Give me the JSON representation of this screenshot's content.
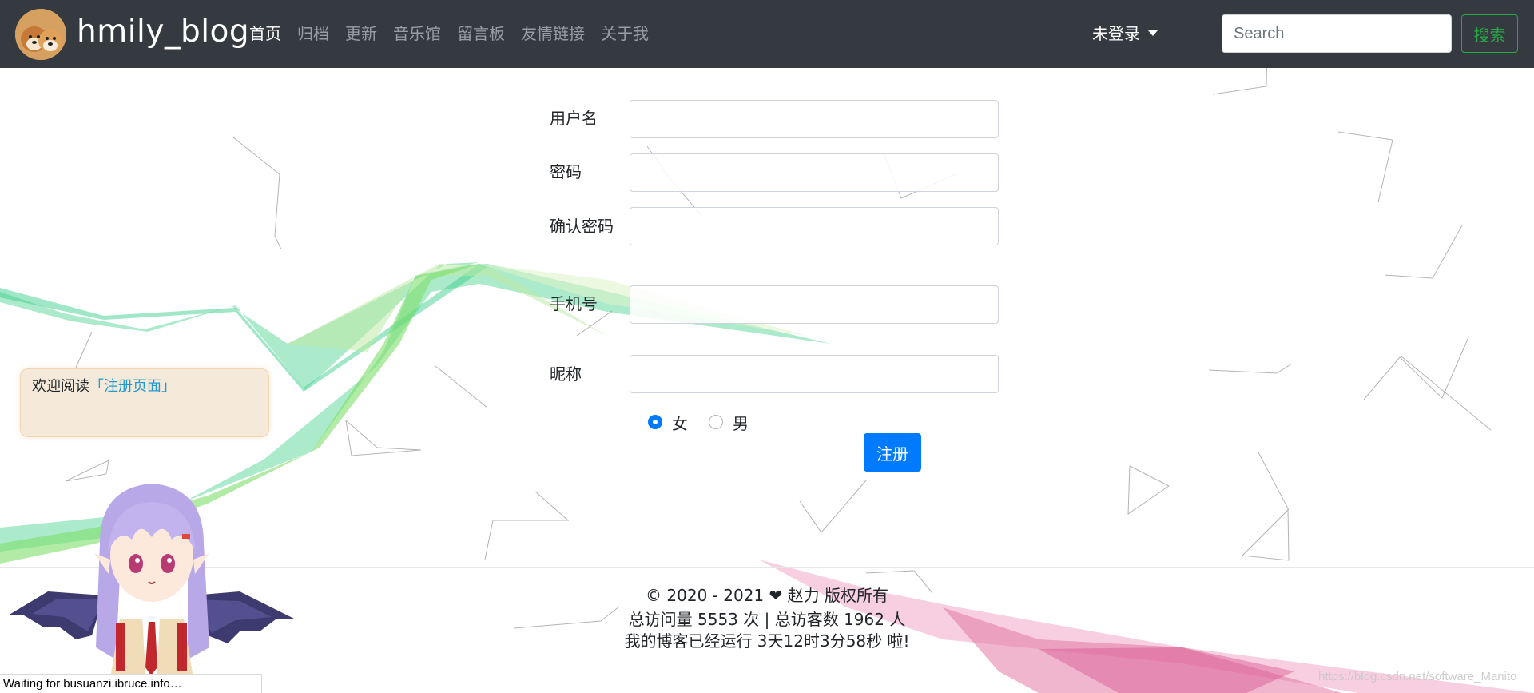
{
  "navbar": {
    "brand": "hmily_blog",
    "links": [
      {
        "label": "首页",
        "active": true
      },
      {
        "label": "归档",
        "active": false
      },
      {
        "label": "更新",
        "active": false
      },
      {
        "label": "音乐馆",
        "active": false
      },
      {
        "label": "留言板",
        "active": false
      },
      {
        "label": "友情链接",
        "active": false
      },
      {
        "label": "关于我",
        "active": false
      }
    ],
    "login_status": "未登录",
    "search_placeholder": "Search",
    "search_button": "搜索"
  },
  "form": {
    "username_label": "用户名",
    "password_label": "密码",
    "confirm_label": "确认密码",
    "phone_label": "手机号",
    "nickname_label": "昵称",
    "gender_options": [
      {
        "label": "女",
        "checked": true
      },
      {
        "label": "男",
        "checked": false
      }
    ],
    "submit_label": "注册"
  },
  "notice": {
    "prefix": "欢迎阅读",
    "link_text": "「注册页面」"
  },
  "footer": {
    "copyright": "© 2020 - 2021 ❤ 赵力 版权所有",
    "visits_line": "总访问量 5553 次 | 总访客数 1962 人",
    "runtime_line": "我的博客已经运行  3天12时3分58秒  啦!"
  },
  "status_bar": "Waiting for busuanzi.ibruce.info…",
  "watermark": "https://blog.csdn.net/software_Manito",
  "colors": {
    "navbar_bg": "#343a40",
    "primary": "#007bff",
    "success": "#28a745",
    "notice_link": "#1f9ad6"
  },
  "icons": {
    "brand": "shiba-dog-avatar",
    "login": "caret-down-icon",
    "mascot": "anime-girl-with-wings"
  }
}
